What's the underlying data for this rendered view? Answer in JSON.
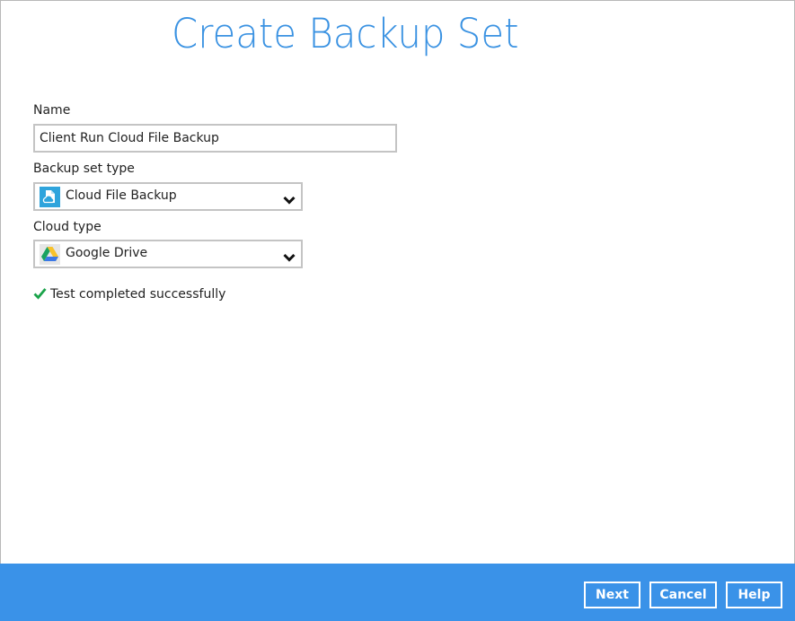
{
  "title": "Create Backup Set",
  "form": {
    "name_label": "Name",
    "name_value": "Client Run Cloud File Backup",
    "backup_type_label": "Backup set type",
    "backup_type_value": "Cloud File Backup",
    "backup_type_icon": "cloud-file-backup-icon",
    "cloud_type_label": "Cloud type",
    "cloud_type_value": "Google Drive",
    "cloud_type_icon": "google-drive-icon"
  },
  "status": {
    "icon": "checkmark-icon",
    "text": "Test completed successfully",
    "color": "#1aa34a"
  },
  "footer": {
    "background": "#3a92e8",
    "next_label": "Next",
    "cancel_label": "Cancel",
    "help_label": "Help"
  },
  "colors": {
    "title": "#3a92e2",
    "accent": "#3a92e8",
    "cloud_icon_bg": "#2fa4dc"
  }
}
